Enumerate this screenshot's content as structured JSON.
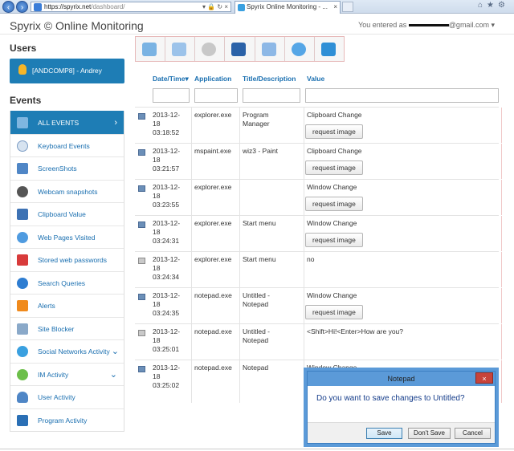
{
  "browser": {
    "url": "https://spyrix.net/dashboard/",
    "url_scheme_host": "https://spyrix.net",
    "url_path": "/dashboard/",
    "tab_title": "Spyrix Online Monitoring - ...",
    "tab_close": "×"
  },
  "header": {
    "brand": "Spyrix © Online Monitoring",
    "account_prefix": "You entered as",
    "account_suffix": "@gmail.com",
    "account_caret": "▾"
  },
  "sidebar": {
    "users_title": "Users",
    "user_label": "[ANDCOMP8] - Andrey",
    "events_title": "Events",
    "items": [
      {
        "label": "ALL EVENTS",
        "active": true,
        "chevron": "›"
      },
      {
        "label": "Keyboard Events"
      },
      {
        "label": "ScreenShots"
      },
      {
        "label": "Webcam snapshots"
      },
      {
        "label": "Clipboard Value"
      },
      {
        "label": "Web Pages Visited"
      },
      {
        "label": "Stored web passwords"
      },
      {
        "label": "Search Queries"
      },
      {
        "label": "Alerts"
      },
      {
        "label": "Site Blocker"
      },
      {
        "label": "Social Networks Activity",
        "chevron": "⌄"
      },
      {
        "label": "IM Activity",
        "chevron": "⌄"
      },
      {
        "label": "User Activity"
      },
      {
        "label": "Program Activity"
      }
    ]
  },
  "table": {
    "headers": {
      "datetime": "Date/Time",
      "sort_icon": "▾",
      "application": "Application",
      "title": "Title/Description",
      "value": "Value"
    },
    "rows": [
      {
        "date": "2013-12-",
        "day": "18",
        "time": "03:18:52",
        "app": "explorer.exe",
        "title1": "Program",
        "title2": "Manager",
        "value": "Clipboard Change",
        "button": "request image",
        "icon": "screen"
      },
      {
        "date": "2013-12-",
        "day": "18",
        "time": "03:21:57",
        "app": "mspaint.exe",
        "title1": "wiz3 - Paint",
        "title2": "",
        "value": "Clipboard Change",
        "button": "request image",
        "icon": "screen"
      },
      {
        "date": "2013-12-",
        "day": "18",
        "time": "03:23:55",
        "app": "explorer.exe",
        "title1": "",
        "title2": "",
        "value": "Window Change",
        "button": "request image",
        "icon": "screen"
      },
      {
        "date": "2013-12-",
        "day": "18",
        "time": "03:24:31",
        "app": "explorer.exe",
        "title1": "Start menu",
        "title2": "",
        "value": "Window Change",
        "button": "request image",
        "icon": "screen"
      },
      {
        "date": "2013-12-",
        "day": "18",
        "time": "03:24:34",
        "app": "explorer.exe",
        "title1": "Start menu",
        "title2": "",
        "value": "no",
        "button": "",
        "icon": "keyboard"
      },
      {
        "date": "2013-12-",
        "day": "18",
        "time": "03:24:35",
        "app": "notepad.exe",
        "title1": "Untitled -",
        "title2": "Notepad",
        "value": "Window Change",
        "button": "request image",
        "icon": "screen"
      },
      {
        "date": "2013-12-",
        "day": "18",
        "time": "03:25:01",
        "app": "notepad.exe",
        "title1": "Untitled -",
        "title2": "Notepad",
        "value": "<Shift>Hi!<Enter>How are you?",
        "button": "",
        "icon": "keyboard"
      },
      {
        "date": "2013-12-",
        "day": "18",
        "time": "03:25:02",
        "app": "notepad.exe",
        "title1": "Notepad",
        "title2": "",
        "value": "Window Change",
        "button": "",
        "icon": "screen"
      }
    ]
  },
  "dialog": {
    "title": "Notepad",
    "close": "×",
    "message": "Do you want to save changes to Untitled?",
    "save": "Save",
    "dont_save": "Don't Save",
    "cancel": "Cancel"
  },
  "colors": {
    "accent": "#1e7db5",
    "link": "#1a6fb0",
    "dialog_frame": "#5b9ad8"
  }
}
